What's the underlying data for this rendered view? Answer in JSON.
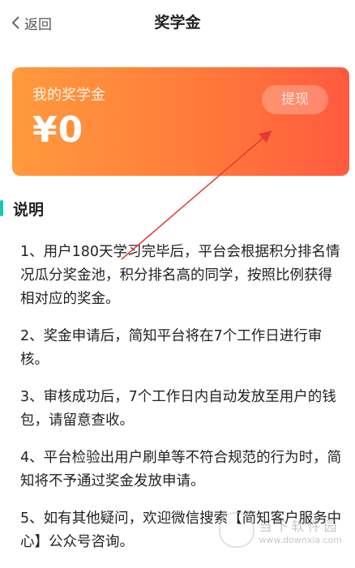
{
  "nav": {
    "back_label": "返回",
    "title": "奖学金"
  },
  "card": {
    "label": "我的奖学金",
    "amount": "¥0",
    "withdraw_label": "提现"
  },
  "section": {
    "title": "说明"
  },
  "rules": [
    "1、用户180天学习完毕后，平台会根据积分排名情况瓜分奖金池，积分排名高的同学，按照比例获得相对应的奖金。",
    "2、奖金申请后，简知平台将在7个工作日进行审核。",
    "3、审核成功后，7个工作日内自动发放至用户的钱包，请留意查收。",
    "4、平台检验出用户刷单等不符合规范的行为时，简知将不予通过奖金发放申请。",
    "5、如有其他疑问，欢迎微信搜索【简知客户服务中心】公众号咨询。"
  ],
  "watermark": {
    "name": "当下软件园",
    "url": "www.downxia.com"
  },
  "colors": {
    "card_gradient_start": "#ff9a3d",
    "card_gradient_end": "#ff5a3f",
    "section_accent": "#14c7b5",
    "annotation_arrow": "#e53935"
  }
}
